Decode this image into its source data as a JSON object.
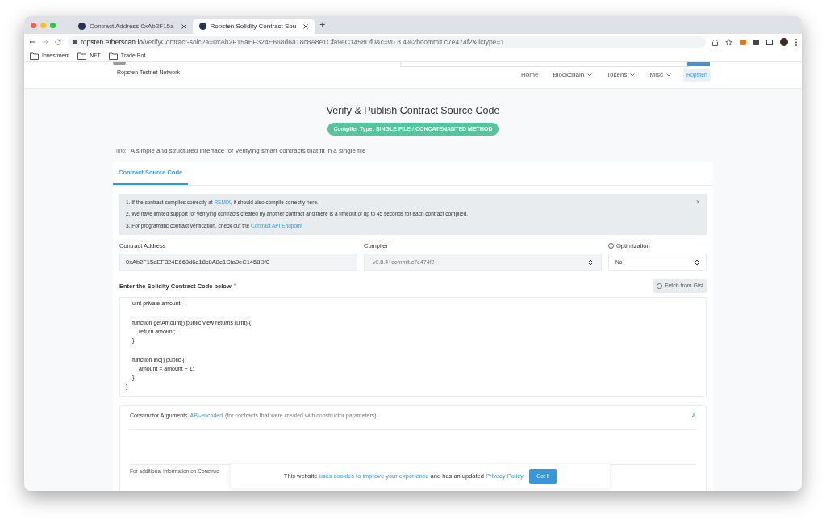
{
  "browser": {
    "tabs": [
      {
        "title": "Contract Address 0xAb2F15a",
        "selected": false
      },
      {
        "title": "Ropsten Solidity Contract Sou",
        "selected": true
      }
    ],
    "new_tab": "+",
    "url": {
      "host": "ropsten.etherscan.io",
      "path": "/verifyContract-solc?a=0xAb2F15aEF324E668d6a18c8A8e1Cfa9eC1458Df0&c=v0.8.4%2bcommit.c7e474f2&lictype=1"
    },
    "bookmarks": [
      "Investment",
      "NFT",
      "Trade Bot"
    ]
  },
  "site": {
    "network_label": "Ropsten Testnet Network",
    "nav": [
      {
        "label": "Home",
        "dropdown": false
      },
      {
        "label": "Blockchain",
        "dropdown": true
      },
      {
        "label": "Tokens",
        "dropdown": true
      },
      {
        "label": "Misc",
        "dropdown": true
      }
    ],
    "network_button": "Ropsten"
  },
  "page": {
    "title": "Verify & Publish Contract Source Code",
    "badge": "Compiler Type: SINGLE FILE / CONCATENANTED METHOD",
    "info": {
      "label": "Info:",
      "text": "A simple and structured interface for verifying smart contracts that fit in a single file"
    },
    "tabs": [
      {
        "label": "Contract Source Code",
        "selected": true
      }
    ],
    "notes": [
      {
        "before": "1. If the contract compiles correctly at ",
        "link": "REMIX",
        "after": ", it should also compile correctly here."
      },
      {
        "before": "2. We have limited support for verifying contracts created by another contract and there is a timeout of up to 45 seconds for each contract compiled."
      },
      {
        "before": "3. For programatic contract verification, check out the ",
        "link": "Contract API Endpoint"
      }
    ],
    "close": "×",
    "fields": {
      "contract_address": {
        "label": "Contract Address",
        "value": "0xAb2F15aEF324E668d6a18c8A8e1Cfa9eC1458Df0"
      },
      "compiler": {
        "label": "Compiler",
        "value": "v0.8.4+commit.c7e474f2",
        "disabled": true
      },
      "optimization": {
        "label": "Optimization",
        "value": "No"
      }
    },
    "code": {
      "label": "Enter the Solidity Contract Code below",
      "required": "*",
      "fetch_button": "Fetch from Gist",
      "blocks": [
        {
          "lines": [
            {
              "text": "uint private amount;"
            }
          ]
        },
        {
          "lines": [
            {
              "text": "function getAmount() public view returns (uint) {",
              "children": [
                {
                  "text": "return amount;"
                }
              ]
            },
            {
              "text": "}"
            }
          ]
        },
        {
          "lines": [
            {
              "text": "function inc() public {",
              "children": [
                {
                  "text": "amount = amount + 1;"
                }
              ]
            },
            {
              "text": "}"
            }
          ]
        }
      ],
      "closing_line": "}"
    },
    "constructor": {
      "label": "Constructor Arguments",
      "link": "ABI-encoded",
      "note": "(for contracts that were created with constructor parameters)",
      "footer": "For additional information on Construc"
    },
    "cookie": {
      "before": "This website ",
      "link1": "uses cookies to improve your experience",
      "middle": " and has an updated ",
      "link2": "Privacy Policy",
      "after": ".",
      "button": "Got It"
    }
  }
}
